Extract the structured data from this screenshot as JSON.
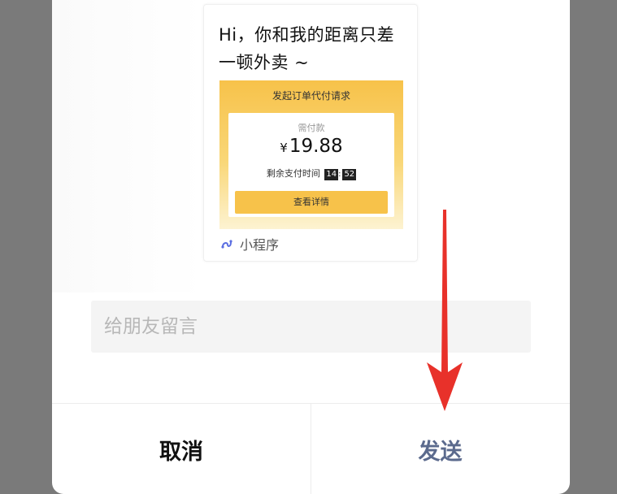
{
  "share_card": {
    "title": "Hi，你和我的距离只差一顿外卖 ~",
    "order_header": "发起订单代付请求",
    "pay_label": "需付款",
    "currency": "¥",
    "amount": "19.88",
    "remaining_label": "剩余支付时间",
    "timer_minutes": "14",
    "timer_seconds": "52",
    "view_details": "查看详情",
    "source_label": "小程序",
    "source_icon": "mini-program-icon",
    "accent_color": "#f7c24a"
  },
  "message": {
    "placeholder": "给朋友留言",
    "value": ""
  },
  "actions": {
    "cancel_label": "取消",
    "send_label": "发送",
    "send_color": "#5b6a8d"
  },
  "annotation": {
    "arrow_color": "#e8312a",
    "arrow_icon": "red-arrow-down-icon"
  }
}
